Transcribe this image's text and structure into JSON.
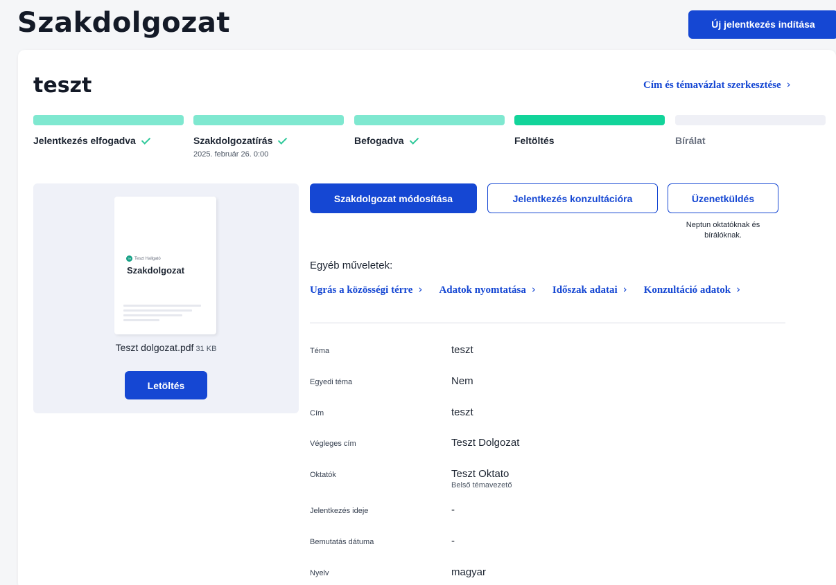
{
  "page": {
    "title": "Szakdolgozat",
    "new_button": "Új jelentkezés indítása"
  },
  "thesis": {
    "title": "teszt",
    "edit_link": "Cím és témavázlat szerkesztése"
  },
  "steps": [
    {
      "label": "Jelentkezés elfogadva",
      "date": "",
      "status": "done"
    },
    {
      "label": "Szakdolgozatírás",
      "date": "2025. február 26. 0:00",
      "status": "done"
    },
    {
      "label": "Befogadva",
      "date": "",
      "status": "done"
    },
    {
      "label": "Feltöltés",
      "date": "",
      "status": "active"
    },
    {
      "label": "Bírálat",
      "date": "",
      "status": "pending"
    }
  ],
  "document": {
    "author": "Teszt Hallgató",
    "avatar_initials": "TH",
    "heading": "Szakdolgozat",
    "file_name": "Teszt dolgozat.pdf",
    "file_size": "31 KB",
    "download_label": "Letöltés"
  },
  "actions": {
    "modify": "Szakdolgozat módosítása",
    "consultation": "Jelentkezés konzultációra",
    "message": "Üzenetküldés",
    "message_note": "Neptun oktatóknak és bírálóknak."
  },
  "other_ops": {
    "label": "Egyéb műveletek:",
    "links": [
      "Ugrás a közösségi térre",
      "Adatok nyomtatása",
      "Időszak adatai",
      "Konzultáció adatok"
    ]
  },
  "details": [
    {
      "key": "Téma",
      "value": "teszt",
      "sub": ""
    },
    {
      "key": "Egyedi téma",
      "value": "Nem",
      "sub": ""
    },
    {
      "key": "Cím",
      "value": "teszt",
      "sub": ""
    },
    {
      "key": "Végleges cím",
      "value": "Teszt Dolgozat",
      "sub": ""
    },
    {
      "key": "Oktatók",
      "value": "Teszt Oktato",
      "sub": "Belső témavezető"
    },
    {
      "key": "Jelentkezés ideje",
      "value": "-",
      "sub": ""
    },
    {
      "key": "Bemutatás dátuma",
      "value": "-",
      "sub": ""
    },
    {
      "key": "Nyelv",
      "value": "magyar",
      "sub": ""
    }
  ],
  "colors": {
    "primary": "#1547d3",
    "step_done": "#7fe8d0",
    "step_active": "#12d49a",
    "step_pending": "#eff0f6",
    "check": "#2fc99a"
  },
  "icons": {
    "chevron": "chevron-right-icon",
    "check": "check-icon"
  }
}
